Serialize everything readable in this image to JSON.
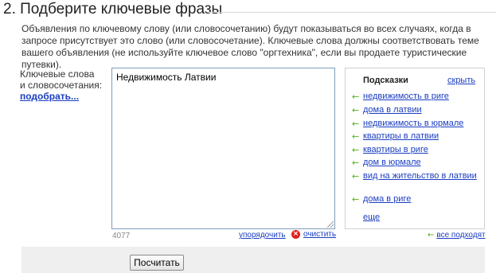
{
  "section": {
    "title": "2. Подберите ключевые фразы",
    "description": "Объявления по ключевому слову (или словосочетанию) будут показываться во всех случаях, когда в запросе присутствует это слово (или словосочетание). Ключевые слова должны соответствовать теме вашего объявления (не используйте ключевое слово \"оргтехника\", если вы продаете туристические путевки)."
  },
  "keywords": {
    "label_line1": "Ключевые слова",
    "label_line2": "и словосочетания:",
    "pick_link": "подобрать...",
    "textarea_value": "Недвижимость Латвии",
    "char_count": "4077",
    "sort_link": "упорядочить",
    "clear_link": "очистить"
  },
  "hints": {
    "title": "Подсказки",
    "hide_link": "скрыть",
    "items": [
      "недвижимость в риге",
      "дома в латвии",
      "недвижимость в юрмале",
      "квартиры в латвии",
      "квартиры в риге",
      "дом в юрмале",
      "вид на жительство в латвии",
      "дома в риге"
    ],
    "more_link": "еще",
    "all_link": "все подходят"
  },
  "actions": {
    "calculate_label": "Посчитать"
  },
  "colors": {
    "link": "#1a3dc1",
    "arrow": "#4caf1a",
    "clear_icon": "#e02020",
    "bottom_bar": "#efefef"
  },
  "icons": {
    "hint_arrow": "left-arrow-icon",
    "clear": "clear-icon"
  }
}
